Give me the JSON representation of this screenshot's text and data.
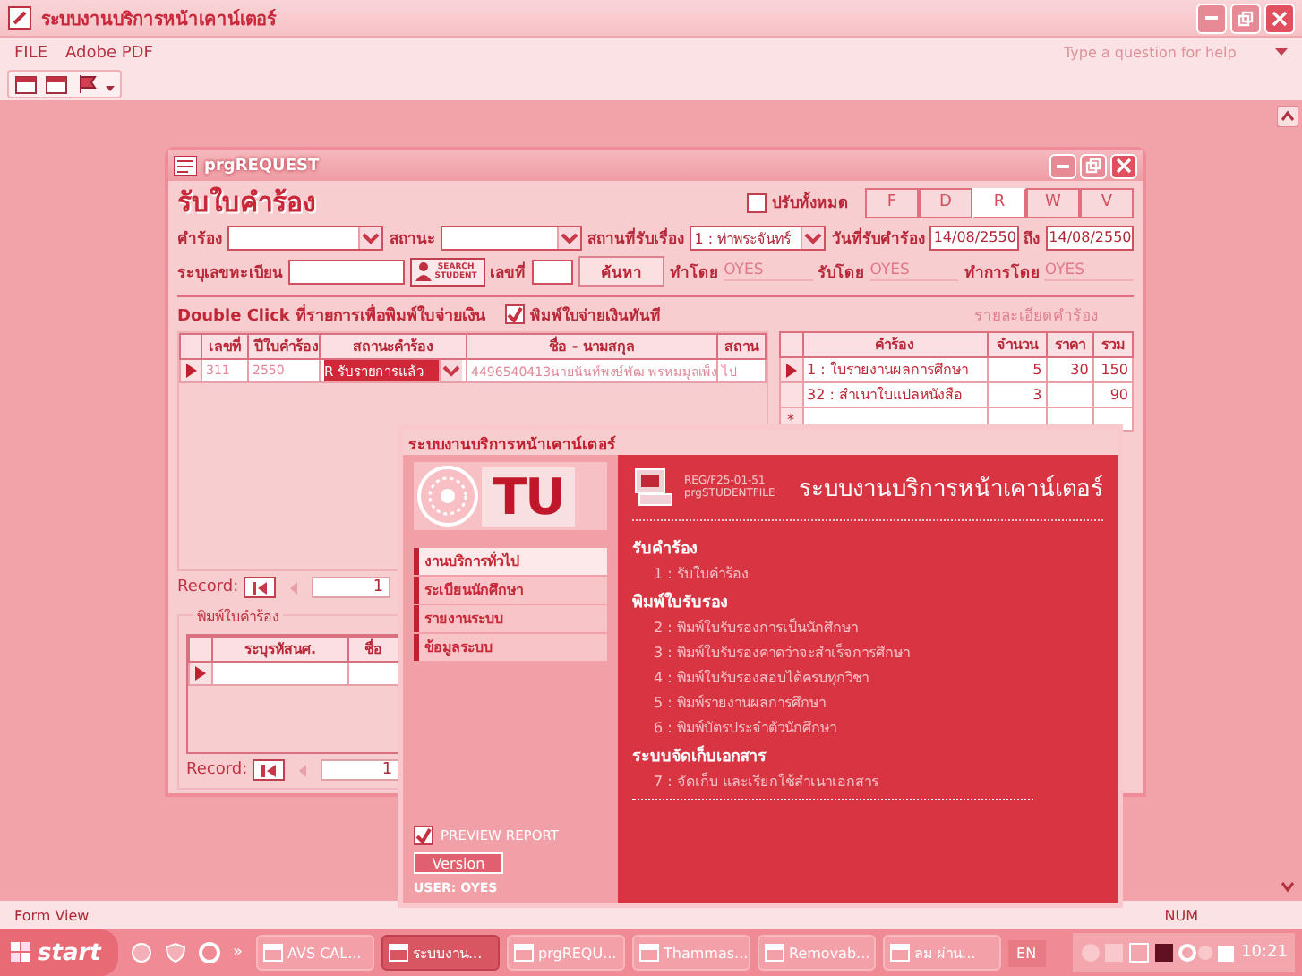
{
  "app": {
    "title": "ระบบงานบริการหน้าเคาน์เตอร์",
    "menu": [
      "FILE",
      "Adobe PDF"
    ],
    "help_placeholder": "Type a question for help"
  },
  "request_form": {
    "title": "prgREQUEST",
    "heading": "รับใบคำร้อง",
    "update_all": {
      "label": "ปรับทั้งหมด",
      "checked": false
    },
    "view_buttons": [
      {
        "label": "F",
        "selected": false
      },
      {
        "label": "D",
        "selected": false
      },
      {
        "label": "R",
        "selected": true
      },
      {
        "label": "W",
        "selected": false
      },
      {
        "label": "V",
        "selected": false
      }
    ],
    "request_label": "คำร้อง",
    "status_label": "สถานะ",
    "place_label": "สถานที่รับเรื่อง",
    "place_value": "1 : ท่าพระจันทร์",
    "date_label": "วันที่รับคำร้อง",
    "date_from": "14/08/2550",
    "to_label": "ถึง",
    "date_to": "14/08/2550",
    "student_id_label": "ระบุเลขทะเบียน",
    "search_student_button": "SEARCH STUDENT",
    "number_label": "เลขที่",
    "find_button": "ค้นหา",
    "made_by_label": "ทำโดย",
    "made_by": "OYES",
    "received_by_label": "รับโดย",
    "received_by": "OYES",
    "processed_by_label": "ทำการโดย",
    "processed_by": "OYES",
    "instruction": "Double Click ที่รายการเพื่อพิมพ์ใบจ่ายเงิน",
    "print_now": {
      "label": "พิมพ์ใบจ่ายเงินทันที",
      "checked": true
    },
    "details_label": "รายละเอียดคำร้อง",
    "requests_table": {
      "columns": [
        "เลขที่",
        "ปีใบคำร้อง",
        "สถานะคำร้อง",
        "ชื่อ - นามสกุล",
        "สถาน"
      ],
      "rows": [
        [
          "311",
          "2550",
          "R  รับรายการแล้ว",
          "4496540413นายนันท์พงษ์พัฒ พรหมมูลเพ็ง",
          "ไป"
        ]
      ]
    },
    "details_table": {
      "columns": [
        "คำร้อง",
        "จำนวน",
        "ราคา",
        "รวม"
      ],
      "rows": [
        [
          "1 : ใบรายงานผลการศึกษา",
          "5",
          "30",
          "150"
        ],
        [
          "32 : สำเนาใบแปลหนังสือ",
          "3",
          "",
          "90"
        ]
      ],
      "new_row_marker": "*"
    },
    "record_nav": {
      "label": "Record:",
      "value": "1"
    },
    "print_subform": {
      "title": "พิมพ์ใบคำร้อง",
      "columns": [
        "ระบุรหัสนศ.",
        "ชื่อ"
      ],
      "record_nav": {
        "label": "Record:",
        "value": "1"
      }
    }
  },
  "menu_window": {
    "title": "ระบบงานบริการหน้าเคาน์เตอร์",
    "logo": "TU",
    "form_code": "REG/F25-01-51",
    "form_name": "prgSTUDENTFILE",
    "heading": "ระบบงานบริการหน้าเคาน์เตอร์",
    "nav": [
      {
        "label": "งานบริการทั่วไป",
        "selected": true
      },
      {
        "label": "ระเบียนนักศึกษา",
        "selected": false
      },
      {
        "label": "รายงานระบบ",
        "selected": false
      },
      {
        "label": "ข้อมูลระบบ",
        "selected": false
      }
    ],
    "sections": [
      {
        "title": "รับคำร้อง",
        "items": [
          "1 : รับใบคำร้อง"
        ]
      },
      {
        "title": "พิมพ์ใบรับรอง",
        "items": [
          "2 : พิมพ์ใบรับรองการเป็นนักศึกษา",
          "3 : พิมพ์ใบรับรองคาดว่าจะสำเร็จการศึกษา",
          "4 : พิมพ์ใบรับรองสอบได้ครบทุกวิชา",
          "5 : พิมพ์รายงานผลการศึกษา",
          "6 : พิมพ์บัตรประจำตัวนักศึกษา"
        ]
      },
      {
        "title": "ระบบจัดเก็บเอกสาร",
        "items": [
          "7 : จัดเก็บ และเรียกใช้สำเนาเอกสาร"
        ]
      }
    ],
    "preview_report": {
      "label": "PREVIEW REPORT",
      "checked": true
    },
    "version_button": "Version",
    "user": "USER: OYES"
  },
  "status_bar": {
    "left": "Form View",
    "right": "NUM"
  },
  "taskbar": {
    "start": "start",
    "more": "»",
    "tasks": [
      {
        "label": "AVS CAL...",
        "selected": false
      },
      {
        "label": "ระบบงาน...",
        "selected": true
      },
      {
        "label": "prgREQU...",
        "selected": false
      },
      {
        "label": "Thammas...",
        "selected": false
      },
      {
        "label": "Removab...",
        "selected": false
      },
      {
        "label": "ลม ผ่าน...",
        "selected": false
      }
    ],
    "language": "EN",
    "clock": "10:21"
  }
}
